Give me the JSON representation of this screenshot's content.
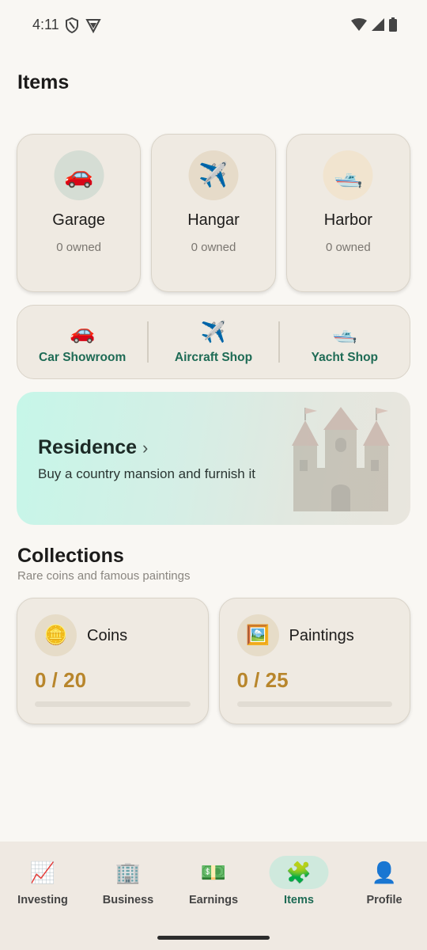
{
  "status_bar": {
    "time": "4:11"
  },
  "page_title": "Items",
  "garages": [
    {
      "name": "Garage",
      "owned": "0 owned",
      "icon": "🚗",
      "circle_color": "#d5ddd4"
    },
    {
      "name": "Hangar",
      "owned": "0 owned",
      "icon": "✈️",
      "circle_color": "#e6dbc9"
    },
    {
      "name": "Harbor",
      "owned": "0 owned",
      "icon": "🛥️",
      "circle_color": "#f1e4cf"
    }
  ],
  "shops": [
    {
      "label": "Car Showroom",
      "icon": "🚗"
    },
    {
      "label": "Aircraft Shop",
      "icon": "✈️"
    },
    {
      "label": "Yacht Shop",
      "icon": "🛥️"
    }
  ],
  "residence": {
    "title": "Residence",
    "chevron": "›",
    "subtitle": "Buy a country mansion and furnish it"
  },
  "collections": {
    "title": "Collections",
    "subtitle": "Rare coins and famous paintings",
    "items": [
      {
        "name": "Coins",
        "progress": "0 / 20",
        "icon": "🪙",
        "fraction": 0
      },
      {
        "name": "Paintings",
        "progress": "0 / 25",
        "icon": "🖼️",
        "fraction": 0
      }
    ]
  },
  "nav": [
    {
      "label": "Investing",
      "icon": "📈",
      "active": false
    },
    {
      "label": "Business",
      "icon": "🏢",
      "active": false
    },
    {
      "label": "Earnings",
      "icon": "💵",
      "active": false
    },
    {
      "label": "Items",
      "icon": "🧩",
      "active": true
    },
    {
      "label": "Profile",
      "icon": "👤",
      "active": false
    }
  ]
}
